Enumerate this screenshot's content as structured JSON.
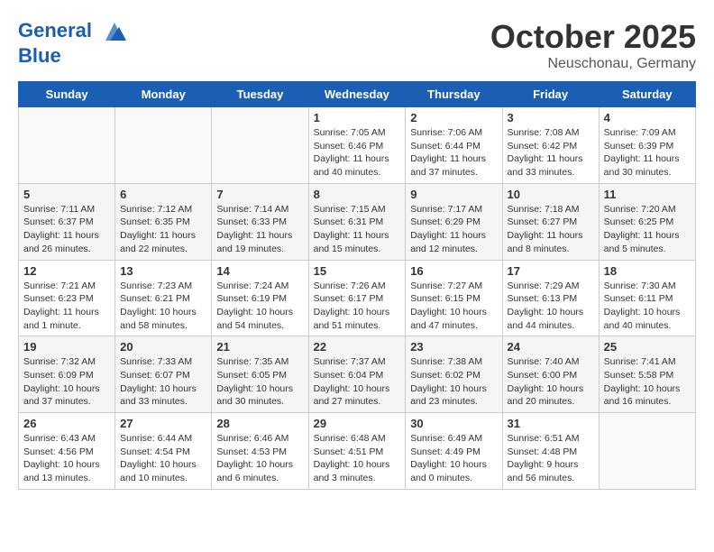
{
  "header": {
    "logo_line1": "General",
    "logo_line2": "Blue",
    "month": "October 2025",
    "location": "Neuschonau, Germany"
  },
  "weekdays": [
    "Sunday",
    "Monday",
    "Tuesday",
    "Wednesday",
    "Thursday",
    "Friday",
    "Saturday"
  ],
  "weeks": [
    [
      {
        "day": "",
        "info": ""
      },
      {
        "day": "",
        "info": ""
      },
      {
        "day": "",
        "info": ""
      },
      {
        "day": "1",
        "info": "Sunrise: 7:05 AM\nSunset: 6:46 PM\nDaylight: 11 hours and 40 minutes."
      },
      {
        "day": "2",
        "info": "Sunrise: 7:06 AM\nSunset: 6:44 PM\nDaylight: 11 hours and 37 minutes."
      },
      {
        "day": "3",
        "info": "Sunrise: 7:08 AM\nSunset: 6:42 PM\nDaylight: 11 hours and 33 minutes."
      },
      {
        "day": "4",
        "info": "Sunrise: 7:09 AM\nSunset: 6:39 PM\nDaylight: 11 hours and 30 minutes."
      }
    ],
    [
      {
        "day": "5",
        "info": "Sunrise: 7:11 AM\nSunset: 6:37 PM\nDaylight: 11 hours and 26 minutes."
      },
      {
        "day": "6",
        "info": "Sunrise: 7:12 AM\nSunset: 6:35 PM\nDaylight: 11 hours and 22 minutes."
      },
      {
        "day": "7",
        "info": "Sunrise: 7:14 AM\nSunset: 6:33 PM\nDaylight: 11 hours and 19 minutes."
      },
      {
        "day": "8",
        "info": "Sunrise: 7:15 AM\nSunset: 6:31 PM\nDaylight: 11 hours and 15 minutes."
      },
      {
        "day": "9",
        "info": "Sunrise: 7:17 AM\nSunset: 6:29 PM\nDaylight: 11 hours and 12 minutes."
      },
      {
        "day": "10",
        "info": "Sunrise: 7:18 AM\nSunset: 6:27 PM\nDaylight: 11 hours and 8 minutes."
      },
      {
        "day": "11",
        "info": "Sunrise: 7:20 AM\nSunset: 6:25 PM\nDaylight: 11 hours and 5 minutes."
      }
    ],
    [
      {
        "day": "12",
        "info": "Sunrise: 7:21 AM\nSunset: 6:23 PM\nDaylight: 11 hours and 1 minute."
      },
      {
        "day": "13",
        "info": "Sunrise: 7:23 AM\nSunset: 6:21 PM\nDaylight: 10 hours and 58 minutes."
      },
      {
        "day": "14",
        "info": "Sunrise: 7:24 AM\nSunset: 6:19 PM\nDaylight: 10 hours and 54 minutes."
      },
      {
        "day": "15",
        "info": "Sunrise: 7:26 AM\nSunset: 6:17 PM\nDaylight: 10 hours and 51 minutes."
      },
      {
        "day": "16",
        "info": "Sunrise: 7:27 AM\nSunset: 6:15 PM\nDaylight: 10 hours and 47 minutes."
      },
      {
        "day": "17",
        "info": "Sunrise: 7:29 AM\nSunset: 6:13 PM\nDaylight: 10 hours and 44 minutes."
      },
      {
        "day": "18",
        "info": "Sunrise: 7:30 AM\nSunset: 6:11 PM\nDaylight: 10 hours and 40 minutes."
      }
    ],
    [
      {
        "day": "19",
        "info": "Sunrise: 7:32 AM\nSunset: 6:09 PM\nDaylight: 10 hours and 37 minutes."
      },
      {
        "day": "20",
        "info": "Sunrise: 7:33 AM\nSunset: 6:07 PM\nDaylight: 10 hours and 33 minutes."
      },
      {
        "day": "21",
        "info": "Sunrise: 7:35 AM\nSunset: 6:05 PM\nDaylight: 10 hours and 30 minutes."
      },
      {
        "day": "22",
        "info": "Sunrise: 7:37 AM\nSunset: 6:04 PM\nDaylight: 10 hours and 27 minutes."
      },
      {
        "day": "23",
        "info": "Sunrise: 7:38 AM\nSunset: 6:02 PM\nDaylight: 10 hours and 23 minutes."
      },
      {
        "day": "24",
        "info": "Sunrise: 7:40 AM\nSunset: 6:00 PM\nDaylight: 10 hours and 20 minutes."
      },
      {
        "day": "25",
        "info": "Sunrise: 7:41 AM\nSunset: 5:58 PM\nDaylight: 10 hours and 16 minutes."
      }
    ],
    [
      {
        "day": "26",
        "info": "Sunrise: 6:43 AM\nSunset: 4:56 PM\nDaylight: 10 hours and 13 minutes."
      },
      {
        "day": "27",
        "info": "Sunrise: 6:44 AM\nSunset: 4:54 PM\nDaylight: 10 hours and 10 minutes."
      },
      {
        "day": "28",
        "info": "Sunrise: 6:46 AM\nSunset: 4:53 PM\nDaylight: 10 hours and 6 minutes."
      },
      {
        "day": "29",
        "info": "Sunrise: 6:48 AM\nSunset: 4:51 PM\nDaylight: 10 hours and 3 minutes."
      },
      {
        "day": "30",
        "info": "Sunrise: 6:49 AM\nSunset: 4:49 PM\nDaylight: 10 hours and 0 minutes."
      },
      {
        "day": "31",
        "info": "Sunrise: 6:51 AM\nSunset: 4:48 PM\nDaylight: 9 hours and 56 minutes."
      },
      {
        "day": "",
        "info": ""
      }
    ]
  ]
}
